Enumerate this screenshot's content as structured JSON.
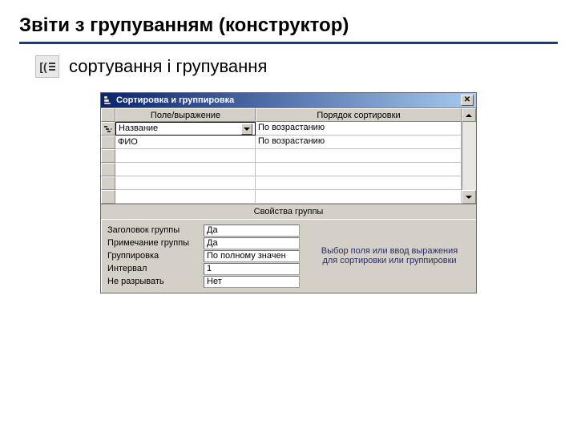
{
  "slide": {
    "title": "Звіти з групуванням (конструктор)",
    "subheading": "сортування і групування"
  },
  "dialog": {
    "title": "Сортировка и группировка",
    "close": "✕",
    "columns": {
      "field": "Поле/выражение",
      "sort": "Порядок сортировки"
    },
    "rows": [
      {
        "field": "Название",
        "sort": "По возрастанию",
        "active": true
      },
      {
        "field": "ФИО",
        "sort": "По возрастанию",
        "active": false
      },
      {
        "field": "",
        "sort": "",
        "active": false
      },
      {
        "field": "",
        "sort": "",
        "active": false
      },
      {
        "field": "",
        "sort": "",
        "active": false
      },
      {
        "field": "",
        "sort": "",
        "active": false
      }
    ],
    "group_props_header": "Свойства группы",
    "props": [
      {
        "label": "Заголовок группы",
        "value": "Да"
      },
      {
        "label": "Примечание группы",
        "value": "Да"
      },
      {
        "label": "Группировка",
        "value": "По полному значен"
      },
      {
        "label": "Интервал",
        "value": "1"
      },
      {
        "label": "Не разрывать",
        "value": "Нет"
      }
    ],
    "help_text": "Выбор поля или ввод выражения для сортировки или группировки"
  }
}
